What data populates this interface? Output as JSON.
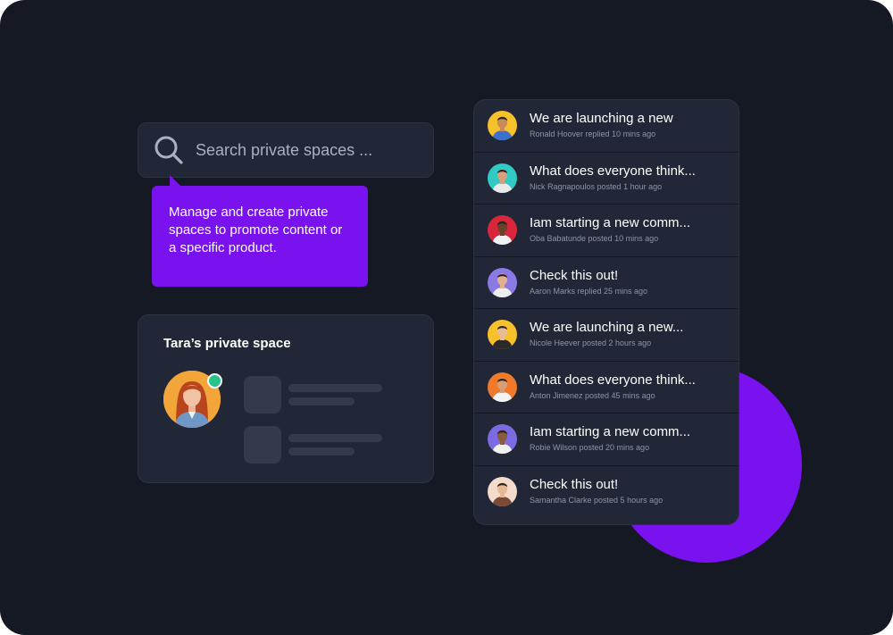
{
  "search": {
    "placeholder": "Search private spaces ...",
    "icon": "search-icon"
  },
  "tooltip": {
    "text": "Manage and create private spaces to promote content or a specific product."
  },
  "space_card": {
    "title": "Tara’s private space",
    "status": "online"
  },
  "activity": [
    {
      "title": "We are launching a new",
      "meta": "Ronald Hoover replied 10 mins ago",
      "avatar_bg": "#f7c12c",
      "skin": "#c98a5c",
      "shirt": "#3b6fd0"
    },
    {
      "title": "What does everyone think...",
      "meta": "Nick Ragnapoulos posted 1 hour ago",
      "avatar_bg": "#30c9c3",
      "skin": "#d8a07a",
      "shirt": "#e9e9e9"
    },
    {
      "title": "Iam starting a new comm...",
      "meta": "Oba Babatunde posted 10 mins ago",
      "avatar_bg": "#d8263b",
      "skin": "#6a412b",
      "shirt": "#f2f2f2"
    },
    {
      "title": "Check this out!",
      "meta": "Aaron Marks replied 25 mins ago",
      "avatar_bg": "#8b79e6",
      "skin": "#e2b08c",
      "shirt": "#eeeeee"
    },
    {
      "title": "We are launching a new...",
      "meta": "Nicole Heever posted 2 hours ago",
      "avatar_bg": "#f7c12c",
      "skin": "#e8bb98",
      "shirt": "#2a2a2a"
    },
    {
      "title": "What does everyone think...",
      "meta": "Anton Jimenez posted 45 mins ago",
      "avatar_bg": "#f07a2a",
      "skin": "#d89c76",
      "shirt": "#f4f4f4"
    },
    {
      "title": "Iam starting a new comm...",
      "meta": "Robie Wilson posted 20 mins ago",
      "avatar_bg": "#7c6ae3",
      "skin": "#8a5a3c",
      "shirt": "#f0f0f0"
    },
    {
      "title": "Check this out!",
      "meta": "Samantha Clarke posted 5 hours ago",
      "avatar_bg": "#f3dccb",
      "skin": "#e6b996",
      "shirt": "#7a4a36"
    }
  ],
  "colors": {
    "accent": "#7a12f0",
    "background": "#141923",
    "card": "#212737",
    "online": "#27c38a"
  }
}
